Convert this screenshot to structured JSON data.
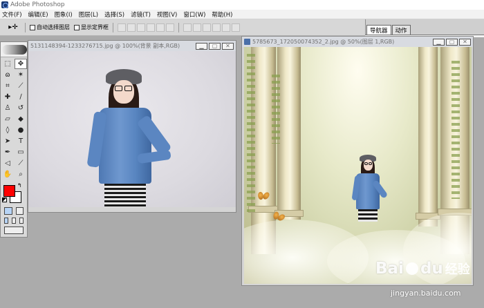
{
  "app": {
    "title": "Adobe Photoshop"
  },
  "menu": [
    "文件(F)",
    "编辑(E)",
    "图象(I)",
    "图层(L)",
    "选择(S)",
    "滤镜(T)",
    "视图(V)",
    "窗口(W)",
    "帮助(H)"
  ],
  "options": {
    "tool_glyph": "▸✛",
    "auto_select_label": "自动选择图层",
    "show_bounds_label": "显示定界框",
    "auto_select_checked": false,
    "show_bounds_checked": false
  },
  "palette": {
    "tabs": [
      "导航器",
      "动作"
    ]
  },
  "toolbox": {
    "foreground_color": "#ff0000",
    "background_color": "#ffffff"
  },
  "doc_left": {
    "title": "5131148394-1233276715.jpg @ 100%(背景 副本,RGB)"
  },
  "doc_right": {
    "title": "5785673_172050074352_2.jpg @ 50%(图层 1,RGB)"
  },
  "watermark": {
    "logo": "Bai",
    "logo_suffix": "du",
    "cn": "经验",
    "url": "jingyan.baidu.com"
  }
}
